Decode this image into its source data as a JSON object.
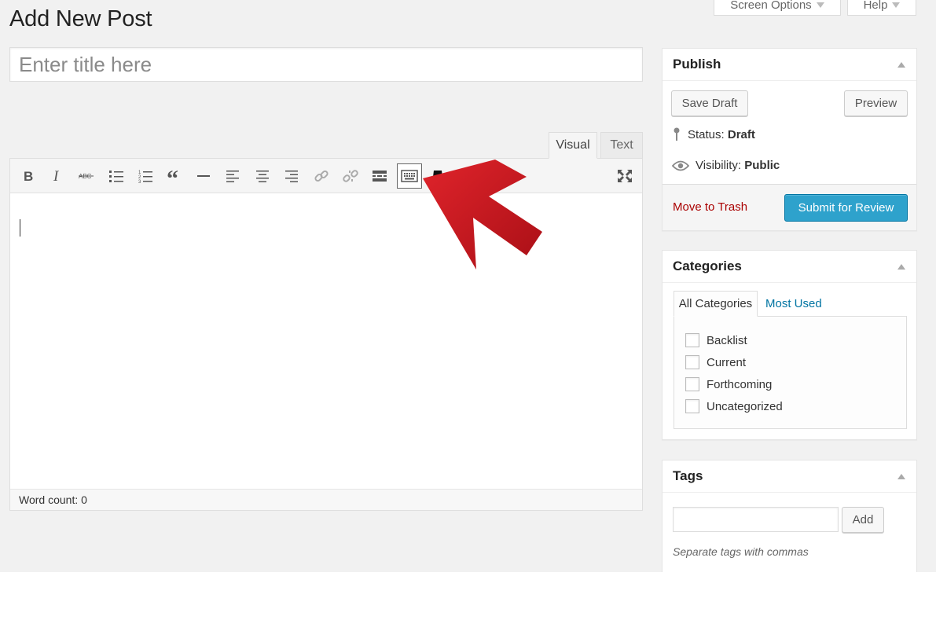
{
  "header": {
    "screen_options_label": "Screen Options",
    "help_label": "Help",
    "page_title": "Add New Post"
  },
  "post": {
    "title_placeholder": "Enter title here"
  },
  "editor": {
    "tabs": [
      {
        "label": "Visual",
        "active": true
      },
      {
        "label": "Text",
        "active": false
      }
    ],
    "toolbar_buttons": [
      {
        "name": "bold-icon"
      },
      {
        "name": "italic-icon"
      },
      {
        "name": "strikethrough-icon"
      },
      {
        "name": "bulleted-list-icon"
      },
      {
        "name": "numbered-list-icon"
      },
      {
        "name": "blockquote-icon"
      },
      {
        "name": "horizontal-line-icon"
      },
      {
        "name": "align-left-icon"
      },
      {
        "name": "align-center-icon"
      },
      {
        "name": "align-right-icon"
      },
      {
        "name": "insert-link-icon"
      },
      {
        "name": "remove-link-icon"
      },
      {
        "name": "read-more-icon"
      },
      {
        "name": "toolbar-toggle-icon",
        "active": true
      },
      {
        "name": "spy-hat-icon"
      },
      {
        "name": "fullscreen-icon"
      }
    ],
    "word_count_label": "Word count: 0"
  },
  "publish": {
    "title": "Publish",
    "save_draft_label": "Save Draft",
    "preview_label": "Preview",
    "status_label": "Status:",
    "status_value": "Draft",
    "visibility_label": "Visibility:",
    "visibility_value": "Public",
    "move_to_trash_label": "Move to Trash",
    "submit_label": "Submit for Review"
  },
  "categories": {
    "title": "Categories",
    "tabs": [
      "All Categories",
      "Most Used"
    ],
    "items": [
      {
        "label": "Backlist",
        "checked": false
      },
      {
        "label": "Current",
        "checked": false
      },
      {
        "label": "Forthcoming",
        "checked": false
      },
      {
        "label": "Uncategorized",
        "checked": false
      }
    ]
  },
  "tags": {
    "title": "Tags",
    "add_label": "Add",
    "hint": "Separate tags with commas"
  },
  "colors": {
    "primary_button": "#2ea2cc",
    "trash_link": "#aa0000",
    "arrow": "#c8161d",
    "link": "#0074a2"
  }
}
